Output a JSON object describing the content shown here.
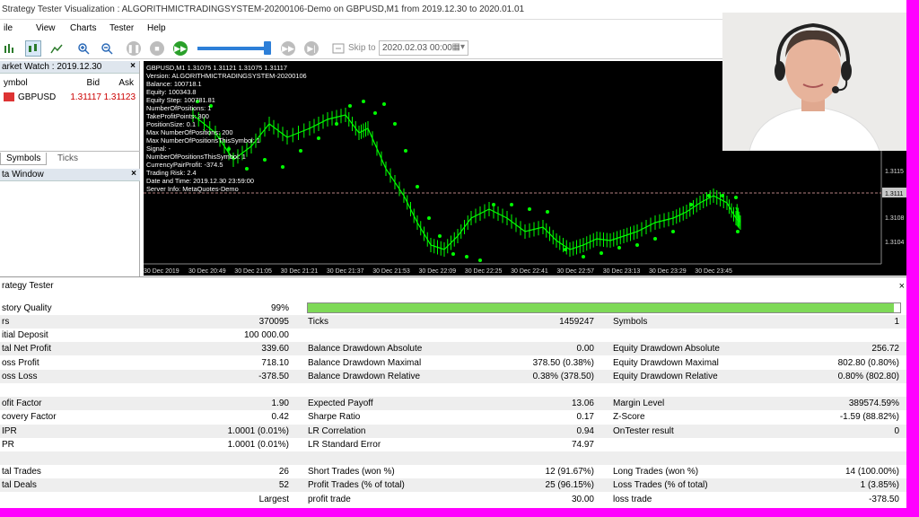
{
  "window": {
    "title": "Strategy Tester Visualization : ALGORITHMICTRADINGSYSTEM-20200106-Demo on GBPUSD,M1 from 2019.12.30 to 2020.01.01"
  },
  "menu": [
    "ile",
    "View",
    "Charts",
    "Tester",
    "Help"
  ],
  "toolbar": {
    "skip_label": "Skip to",
    "date_value": "2020.02.03 00:00",
    "slider_percent": 95
  },
  "market_watch": {
    "title": "arket Watch : 2019.12.30",
    "columns": {
      "symbol": "ymbol",
      "bid": "Bid",
      "ask": "Ask"
    },
    "row": {
      "symbol": "GBPUSD",
      "bid": "1.31117",
      "ask": "1.31123"
    },
    "tabs": [
      "Symbols",
      "Ticks"
    ]
  },
  "data_window": {
    "title": "ta Window"
  },
  "chart": {
    "info_lines": [
      "GBPUSD,M1  1.31075 1.31121 1.31075 1.31117",
      "Version: ALGORITHMICTRADINGSYSTEM-20200106",
      "Balance: 100718.1",
      "Equity: 100343.8",
      "Equity Step: 100781.81",
      "NumberOfPositions: 1",
      "TakeProfitPoints: 300",
      "PositionSize: 0.1",
      "Max NumberOfPositions: 200",
      "Max NumberOfPositionsThisSymbol: 1",
      "Signal: -",
      "NumberOfPositionsThisSymbol: 1",
      "CurrencyPairProfit: -374.5",
      "Trading Risk: 2.4",
      "Date and Time: 2019.12.30 23:59:00",
      "Server Info: MetaQuotes-Demo"
    ],
    "price_labels": [
      "1.3115",
      "1.3111",
      "1.3108",
      "1.3104"
    ],
    "time_labels": [
      "30 Dec 2019",
      "30 Dec 20:49",
      "30 Dec 21:05",
      "30 Dec 21:21",
      "30 Dec 21:37",
      "30 Dec 21:53",
      "30 Dec 22:09",
      "30 Dec 22:25",
      "30 Dec 22:41",
      "30 Dec 22:57",
      "30 Dec 23:13",
      "30 Dec 23:29",
      "30 Dec 23:45"
    ],
    "colors": {
      "background": "#000000",
      "candles": "#00ff00"
    }
  },
  "tester": {
    "title": "rategy Tester",
    "quality": {
      "label": "story Quality",
      "value": "99%",
      "percent": 99
    },
    "rows": [
      {
        "c1l": "rs",
        "c1v": "370095",
        "c2l": "Ticks",
        "c2v": "1459247",
        "c3l": "Symbols",
        "c3v": "1",
        "shade": true
      },
      {
        "c1l": "itial Deposit",
        "c1v": "100 000.00",
        "c2l": "",
        "c2v": "",
        "c3l": "",
        "c3v": "",
        "shade": false
      },
      {
        "c1l": "tal Net Profit",
        "c1v": "339.60",
        "c2l": "Balance Drawdown Absolute",
        "c2v": "0.00",
        "c3l": "Equity Drawdown Absolute",
        "c3v": "256.72",
        "shade": true
      },
      {
        "c1l": "oss Profit",
        "c1v": "718.10",
        "c2l": "Balance Drawdown Maximal",
        "c2v": "378.50 (0.38%)",
        "c3l": "Equity Drawdown Maximal",
        "c3v": "802.80 (0.80%)",
        "shade": false
      },
      {
        "c1l": "oss Loss",
        "c1v": "-378.50",
        "c2l": "Balance Drawdown Relative",
        "c2v": "0.38% (378.50)",
        "c3l": "Equity Drawdown Relative",
        "c3v": "0.80% (802.80)",
        "shade": true
      },
      {
        "c1l": "",
        "c1v": "",
        "c2l": "",
        "c2v": "",
        "c3l": "",
        "c3v": "",
        "shade": false
      },
      {
        "c1l": "ofit Factor",
        "c1v": "1.90",
        "c2l": "Expected Payoff",
        "c2v": "13.06",
        "c3l": "Margin Level",
        "c3v": "389574.59%",
        "shade": true
      },
      {
        "c1l": "covery Factor",
        "c1v": "0.42",
        "c2l": "Sharpe Ratio",
        "c2v": "0.17",
        "c3l": "Z-Score",
        "c3v": "-1.59 (88.82%)",
        "shade": false
      },
      {
        "c1l": "IPR",
        "c1v": "1.0001 (0.01%)",
        "c2l": "LR Correlation",
        "c2v": "0.94",
        "c3l": "OnTester result",
        "c3v": "0",
        "shade": true
      },
      {
        "c1l": "PR",
        "c1v": "1.0001 (0.01%)",
        "c2l": "LR Standard Error",
        "c2v": "74.97",
        "c3l": "",
        "c3v": "",
        "shade": false
      },
      {
        "c1l": "",
        "c1v": "",
        "c2l": "",
        "c2v": "",
        "c3l": "",
        "c3v": "",
        "shade": true
      },
      {
        "c1l": "tal Trades",
        "c1v": "26",
        "c2l": "Short Trades (won %)",
        "c2v": "12 (91.67%)",
        "c3l": "Long Trades (won %)",
        "c3v": "14 (100.00%)",
        "shade": false
      },
      {
        "c1l": "tal Deals",
        "c1v": "52",
        "c2l": "Profit Trades (% of total)",
        "c2v": "25 (96.15%)",
        "c3l": "Loss Trades (% of total)",
        "c3v": "1 (3.85%)",
        "shade": true
      },
      {
        "c1l": "",
        "c1v": "Largest",
        "c2l": "profit trade",
        "c2v": "30.00",
        "c3l": "loss trade",
        "c3v": "-378.50",
        "shade": false
      }
    ]
  }
}
